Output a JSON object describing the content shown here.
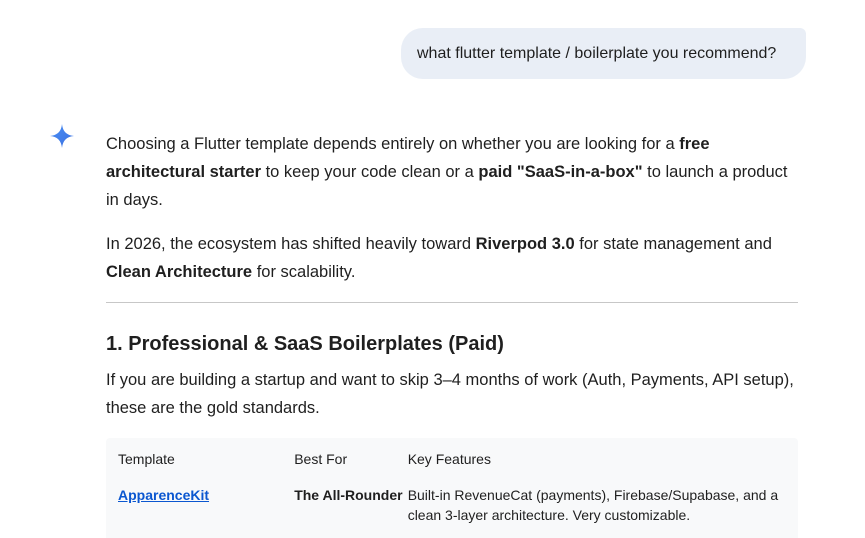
{
  "conversation": {
    "user_message": "what flutter template / boilerplate you recommend?"
  },
  "response": {
    "icon": "gemini-sparkle-icon",
    "intro": {
      "t1": "Choosing a Flutter template depends entirely on whether you are looking for a ",
      "b1": "free architectural starter",
      "t2": " to keep your code clean or a ",
      "b2": "paid \"SaaS-in-a-box\"",
      "t3": " to launch a product in days."
    },
    "ecosystem": {
      "t1": "In 2026, the ecosystem has shifted heavily toward ",
      "b1": "Riverpod 3.0",
      "t2": " for state management and ",
      "b2": "Clean Architecture",
      "t3": " for scalability."
    },
    "section1": {
      "heading": "1. Professional & SaaS Boilerplates (Paid)",
      "description": "If you are building a startup and want to skip 3–4 months of work (Auth, Payments, API setup), these are the gold standards."
    },
    "table": {
      "headers": [
        "Template",
        "Best For",
        "Key Features"
      ],
      "rows": [
        {
          "template": "ApparenceKit",
          "best_for": "The All-Rounder",
          "features": "Built-in RevenueCat (payments), Firebase/Supabase, and a clean 3-layer architecture. Very customizable."
        }
      ]
    }
  },
  "colors": {
    "user_bubble": "#e9eef6",
    "link": "#0b57d0",
    "sparkle": "#4285f4",
    "table_bg": "#f8f9fa",
    "divider": "#c7c7c7"
  }
}
